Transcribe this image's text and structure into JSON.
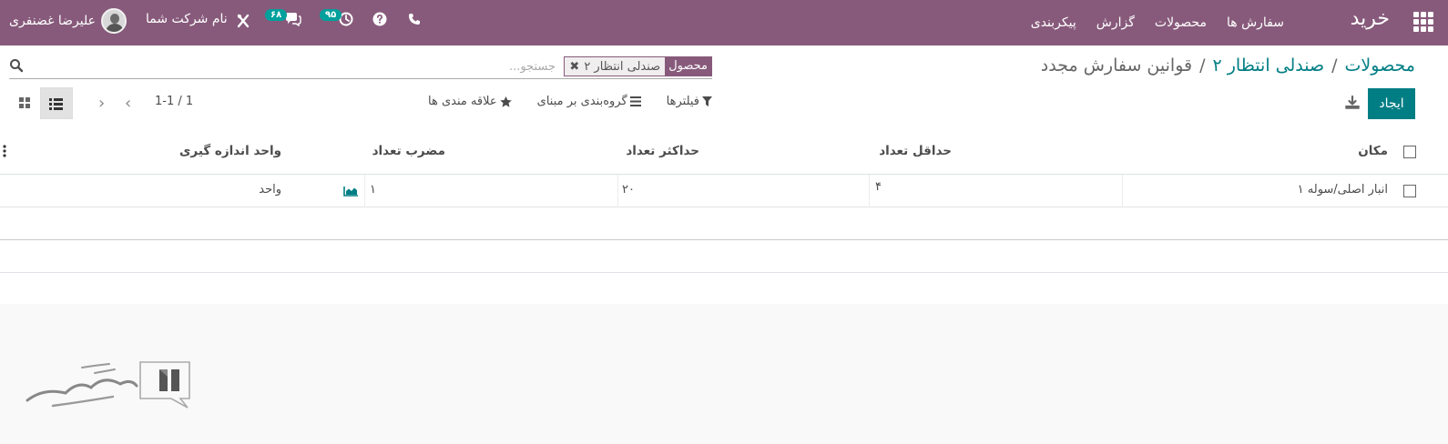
{
  "navbar": {
    "app_name": "خرید",
    "menu": [
      "سفارش ها",
      "محصولات",
      "گزارش",
      "پیکربندی"
    ],
    "company": "نام شرکت شما",
    "user": "علیرضا غضنفری",
    "messages_count": "۶۸",
    "activities_count": "۹۵",
    "bg_color": "#875a7b"
  },
  "breadcrumb": {
    "items": [
      "محصولات",
      "صندلی انتظار ۲"
    ],
    "current": "قوانین سفارش مجدد"
  },
  "search": {
    "facet_label": "محصول",
    "facet_value": "صندلی انتظار ۲",
    "placeholder": "جستجو..."
  },
  "toolbar": {
    "create_label": "ایجاد",
    "filters_label": "فیلترها",
    "groupby_label": "گروه‌بندی بر مبنای",
    "favorites_label": "علاقه مندی ها",
    "pager_text": "1-1 / 1"
  },
  "table": {
    "columns": [
      "مکان",
      "حداقل تعداد",
      "حداکثر تعداد",
      "مضرب تعداد",
      "واحد اندازه گیری"
    ],
    "rows": [
      {
        "location": "انبار اصلی/سوله ۱",
        "min_qty": "۴",
        "max_qty": "۲۰",
        "multiple_qty": "۱",
        "uom": "واحد"
      }
    ]
  },
  "accent_color": "#017e84"
}
